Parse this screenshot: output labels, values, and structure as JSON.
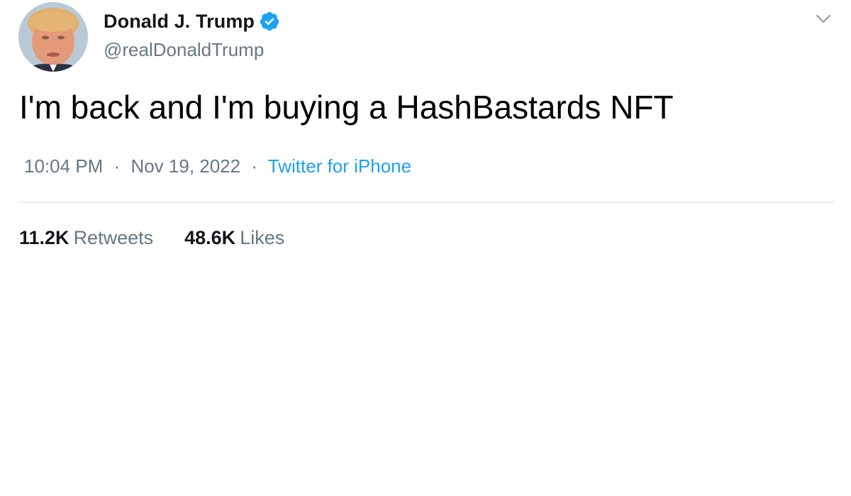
{
  "author": {
    "display_name": "Donald J. Trump",
    "handle": "@realDonaldTrump",
    "verified": true
  },
  "tweet": {
    "text": "I'm back and I'm buying a HashBastards NFT",
    "time": "10:04 PM",
    "date": "Nov 19, 2022",
    "separator": "·",
    "source": "Twitter for iPhone"
  },
  "stats": {
    "retweets_count": "11.2K",
    "retweets_label": "Retweets",
    "likes_count": "48.6K",
    "likes_label": "Likes"
  },
  "icons": {
    "verified": "verified-badge-icon",
    "menu": "chevron-down-icon"
  },
  "colors": {
    "accent": "#1da1f2",
    "muted": "#657786",
    "text": "#14171a"
  }
}
